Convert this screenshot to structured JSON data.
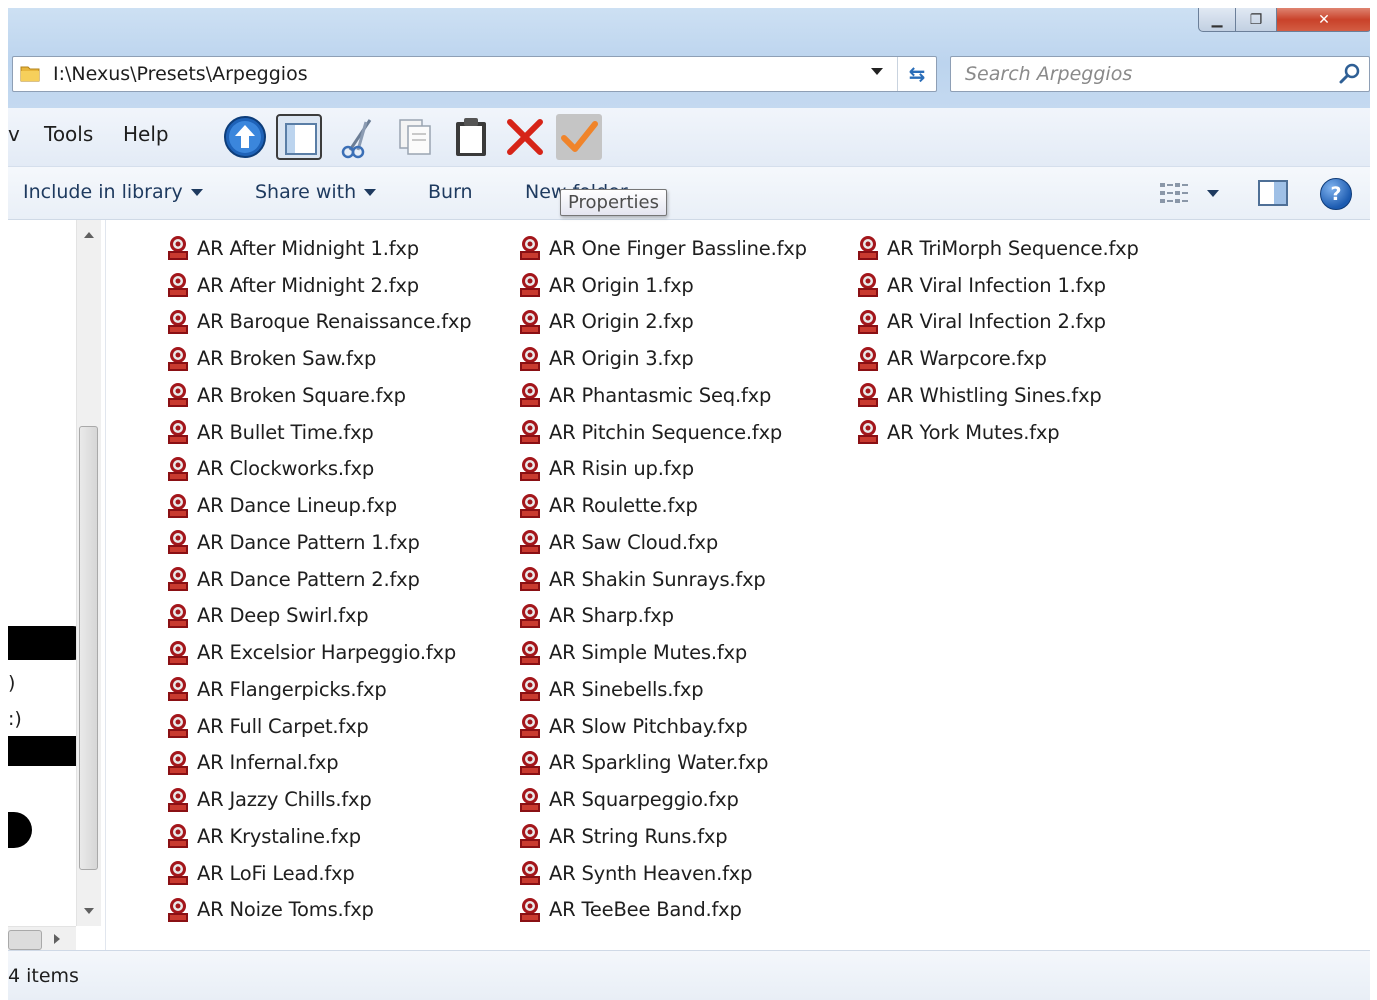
{
  "address": {
    "path": "I:\\Nexus\\Presets\\Arpeggios"
  },
  "search": {
    "placeholder": "Search Arpeggios"
  },
  "menu": {
    "cut_prefix": "v",
    "tools": "Tools",
    "help": "Help"
  },
  "toolbar_icons": [
    "up-arrow-icon",
    "preview-pane-icon",
    "cut-icon",
    "copy-icon",
    "paste-icon",
    "delete-icon",
    "apply-checkmark-icon"
  ],
  "commands": {
    "include_in_library": "Include in library",
    "share_with": "Share with",
    "burn": "Burn",
    "new_folder": "New folder"
  },
  "tooltip": "Properties",
  "nav_fragments": [
    ")",
    ":)"
  ],
  "files": {
    "column1": [
      "AR After Midnight 1.fxp",
      "AR After Midnight 2.fxp",
      "AR Baroque Renaissance.fxp",
      "AR Broken Saw.fxp",
      "AR Broken Square.fxp",
      "AR Bullet Time.fxp",
      "AR Clockworks.fxp",
      "AR Dance Lineup.fxp",
      "AR Dance Pattern 1.fxp",
      "AR Dance Pattern 2.fxp",
      "AR Deep Swirl.fxp",
      "AR Excelsior Harpeggio.fxp",
      "AR Flangerpicks.fxp",
      "AR Full Carpet.fxp",
      "AR Infernal.fxp",
      "AR Jazzy Chills.fxp",
      "AR Krystaline.fxp",
      "AR LoFi Lead.fxp",
      "AR Noize Toms.fxp"
    ],
    "column2": [
      "AR One Finger Bassline.fxp",
      "AR Origin 1.fxp",
      "AR Origin 2.fxp",
      "AR Origin 3.fxp",
      "AR Phantasmic Seq.fxp",
      "AR Pitchin Sequence.fxp",
      "AR Risin up.fxp",
      "AR Roulette.fxp",
      "AR Saw Cloud.fxp",
      "AR Shakin Sunrays.fxp",
      "AR Sharp.fxp",
      "AR Simple Mutes.fxp",
      "AR Sinebells.fxp",
      "AR Slow Pitchbay.fxp",
      "AR Sparkling Water.fxp",
      "AR Squarpeggio.fxp",
      "AR String Runs.fxp",
      "AR Synth Heaven.fxp",
      "AR TeeBee Band.fxp"
    ],
    "column3": [
      "AR TriMorph Sequence.fxp",
      "AR Viral Infection 1.fxp",
      "AR Viral Infection 2.fxp",
      "AR Warpcore.fxp",
      "AR Whistling Sines.fxp",
      "AR York Mutes.fxp"
    ]
  },
  "status": {
    "count": "4 items"
  },
  "colors": {
    "title_bar": "#bcd4ee",
    "close_button": "#c9422a",
    "fxp_icon": "#a3161b"
  }
}
